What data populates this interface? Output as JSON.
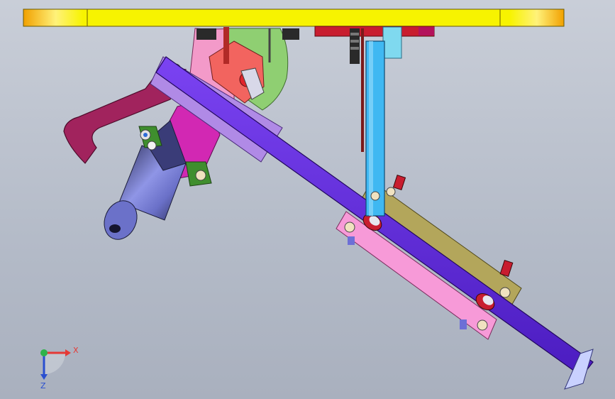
{
  "viewport": {
    "background_top": "#c9ced8",
    "background_bottom": "#a9b0be"
  },
  "colors": {
    "top_plate": "#f7f300",
    "top_plate_end": "#f2a300",
    "main_arm": "#6a2fe0",
    "main_arm_dark": "#3e15a5",
    "lavender_plate": "#b08ae6",
    "pink_link": "#f79ad8",
    "olive_link": "#b3a65b",
    "blue_rod": "#3fb8f2",
    "magenta_hook": "#a1235d",
    "motor_body": "#7a80d6",
    "bracket_magenta": "#d228b3",
    "salmon_block": "#f2645f",
    "green_disc": "#8fcf72",
    "pink_disc": "#f39ac9",
    "red_parts": "#c81d2f"
  },
  "triad": {
    "x_label": "X",
    "z_label": "Z",
    "x_color": "#e53935",
    "y_color": "#2fb34a",
    "z_color": "#2a4fd0"
  }
}
